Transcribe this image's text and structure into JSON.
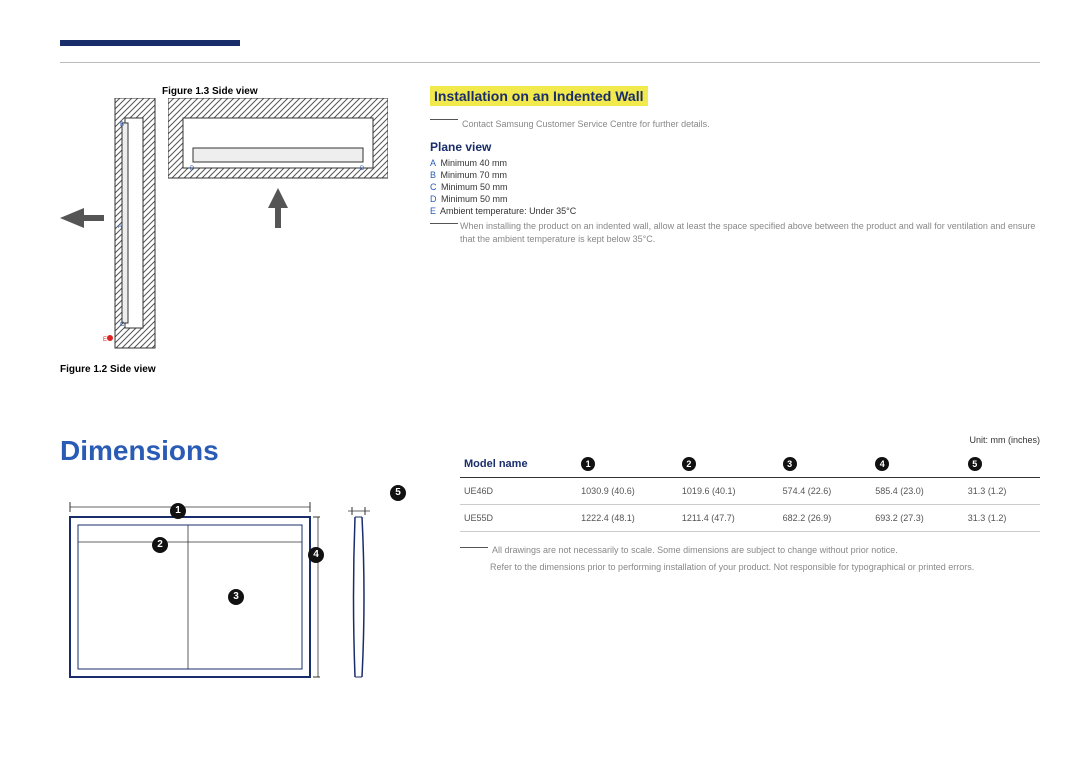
{
  "figures": {
    "fig13": "Figure 1.3 Side view",
    "fig12": "Figure 1.2 Side view",
    "labels": {
      "A": "A",
      "B": "B",
      "C": "C",
      "D": "D",
      "E": "E"
    }
  },
  "indented": {
    "heading": "Installation on an Indented Wall",
    "contact": "Contact Samsung Customer Service Centre for further details.",
    "plane_view": "Plane view",
    "specs": {
      "A": "Minimum 40 mm",
      "B": "Minimum 70 mm",
      "C": "Minimum 50 mm",
      "D": "Minimum 50 mm",
      "E": "Ambient temperature: Under 35°C"
    },
    "install_note": "When installing the product on an indented wall, allow at least the space specified above between the product and wall for ventilation and ensure that the ambient temperature is kept below 35°C."
  },
  "dimensions": {
    "title": "Dimensions",
    "unit": "Unit: mm (inches)",
    "headers": {
      "model": "Model name",
      "c1": "1",
      "c2": "2",
      "c3": "3",
      "c4": "4",
      "c5": "5"
    },
    "rows": [
      {
        "model": "UE46D",
        "c1": "1030.9 (40.6)",
        "c2": "1019.6 (40.1)",
        "c3": "574.4 (22.6)",
        "c4": "585.4 (23.0)",
        "c5": "31.3 (1.2)"
      },
      {
        "model": "UE55D",
        "c1": "1222.4 (48.1)",
        "c2": "1211.4 (47.7)",
        "c3": "682.2 (26.9)",
        "c4": "693.2 (27.3)",
        "c5": "31.3 (1.2)"
      }
    ],
    "footnote_a": "All drawings are not necessarily to scale. Some dimensions are subject to change without prior notice.",
    "footnote_b": "Refer to the dimensions prior to performing installation of your product. Not responsible for typographical or printed errors."
  }
}
